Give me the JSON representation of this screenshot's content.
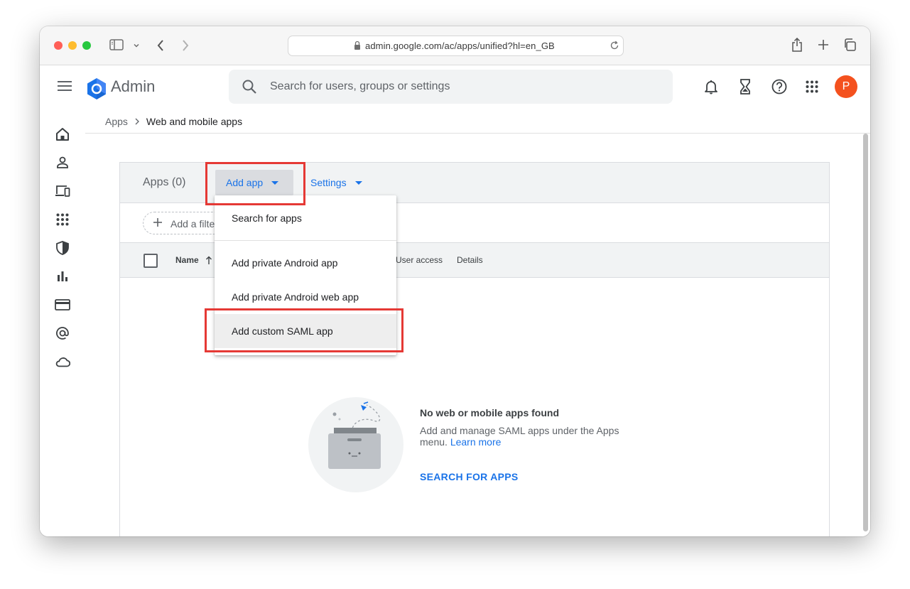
{
  "browser": {
    "url": "admin.google.com/ac/apps/unified?hl=en_GB"
  },
  "header": {
    "brand": "Admin",
    "search_placeholder": "Search for users, groups or settings",
    "avatar_initial": "P"
  },
  "breadcrumb": {
    "parent": "Apps",
    "current": "Web and mobile apps"
  },
  "apps_panel": {
    "title": "Apps (0)",
    "add_app_label": "Add app",
    "settings_label": "Settings",
    "filter_label": "Add a filte",
    "columns": {
      "name": "Name",
      "user_access": "User access",
      "details": "Details"
    }
  },
  "dropdown_menu": {
    "items": [
      "Search for apps",
      "Add private Android app",
      "Add private Android web app",
      "Add custom SAML app"
    ]
  },
  "empty_state": {
    "title": "No web or mobile apps found",
    "description": "Add and manage SAML apps under the Apps menu.",
    "learn_more": "Learn more",
    "action": "SEARCH FOR APPS"
  },
  "colors": {
    "accent": "#1a73e8",
    "highlight": "#e53935",
    "avatar": "#f4511e"
  }
}
